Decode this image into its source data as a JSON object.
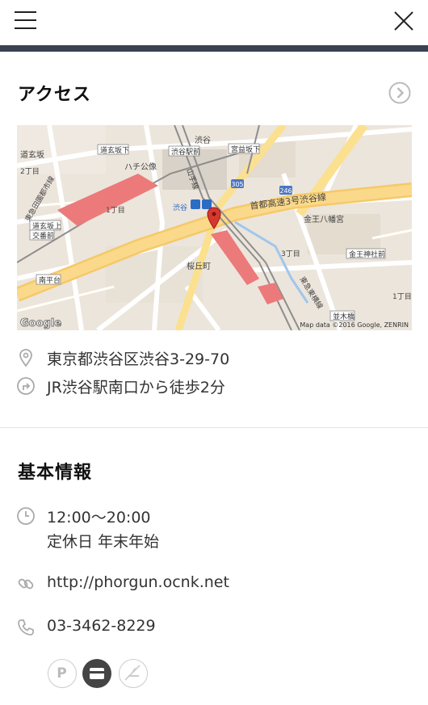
{
  "header": {
    "menu_icon": "hamburger-icon",
    "close_icon": "close-icon"
  },
  "access": {
    "title": "アクセス",
    "more_icon": "chevron-right-circle-icon",
    "address": "東京都渋谷区渋谷3-29-70",
    "directions": "JR渋谷駅南口から徒歩2分",
    "map": {
      "attribution": "Map data ©2016 Google, ZENRIN",
      "logo": "Google",
      "labels": {
        "shibuya": "渋谷",
        "dogenzaka": "道玄坂",
        "dogenzaka_2": "2丁目",
        "dogenzaka_shita": "道玄坂下",
        "shibuya_ekimae": "渋谷駅前",
        "miyamasuzaka": "宮益坂下",
        "hachiko": "ハチ公像",
        "yamanote": "山手線",
        "shibuya_station": "渋谷",
        "rt305": "305",
        "rt246": "246",
        "expressway": "首都高速3号渋谷線",
        "konno_hachimangu": "金王八幡宮",
        "denentoshi": "東急田園都市線",
        "itchome": "1丁目",
        "dogenzaka_ue": "道玄坂上",
        "kosaten": "交番前",
        "sakuragaoka": "桜丘町",
        "sanchome": "3丁目",
        "konno_shrine": "金王神社前",
        "toyoko": "東急東横線",
        "nanpeidai": "南平台",
        "namiki": "並木橋",
        "itchome_2": "1丁目"
      }
    }
  },
  "info": {
    "title": "基本情報",
    "hours": "12:00〜20:00",
    "holiday": "定休日 年末年始",
    "url": "http://phorgun.ocnk.net",
    "phone": "03-3462-8229",
    "badges": [
      {
        "icon": "parking-icon",
        "label": "P",
        "active": false
      },
      {
        "icon": "credit-card-icon",
        "active": true
      },
      {
        "icon": "no-smoking-icon",
        "active": false
      }
    ]
  }
}
